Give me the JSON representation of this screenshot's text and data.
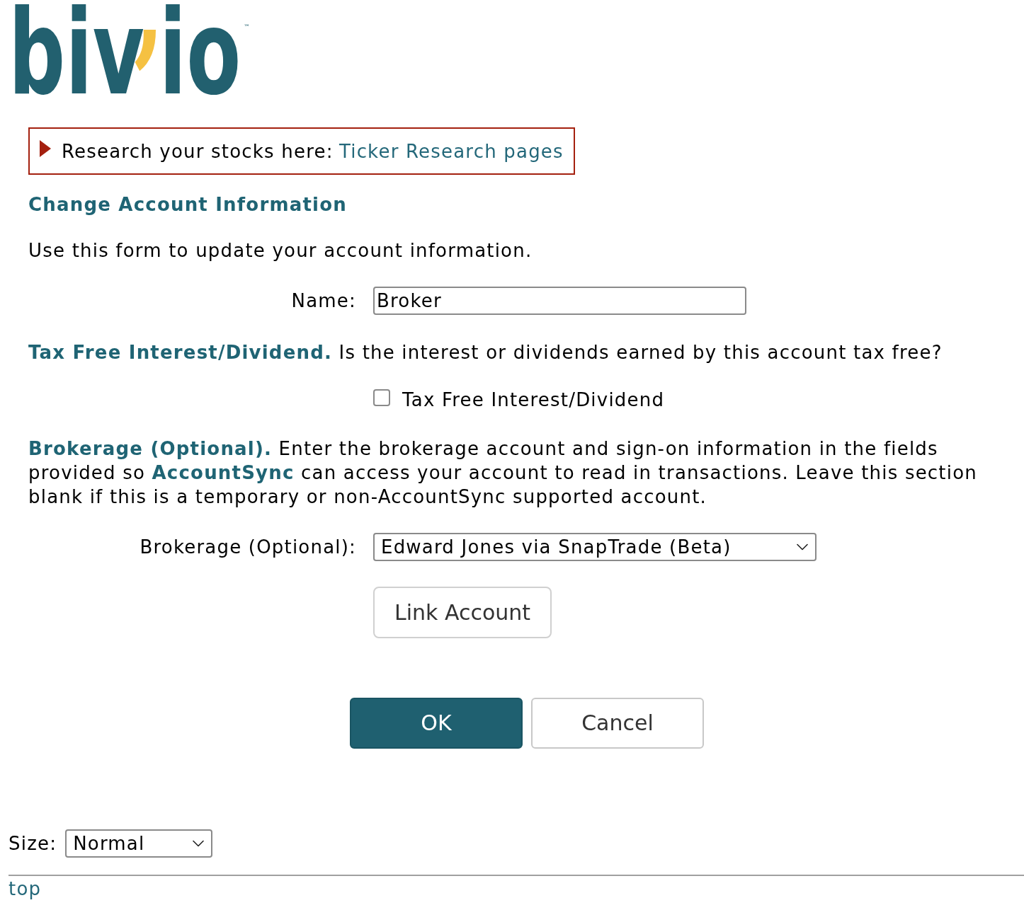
{
  "logo": {
    "text": "biv$^{,}$io",
    "mark": "™"
  },
  "notice": {
    "text": "Research your stocks here:",
    "link": "Ticker Research pages"
  },
  "heading": "Change Account Information",
  "intro": "Use this form to update your account information.",
  "name_field": {
    "label": "Name:",
    "value": "Broker"
  },
  "tax_free": {
    "description": "**Tax Free Interest/Dividend.** Is the interest or dividends earned by this account tax free?",
    "checkbox": {
      "label": "Tax Free Interest/Dividend",
      "checked": false
    }
  },
  "brokerage": {
    "description": "**Brokerage (Optional).** Enter the brokerage account and sign-on information in the fields provided so **AccountSync** can access your account to read in transactions. Leave this section blank if this is a temporary or non-AccountSync supported account.",
    "select": {
      "label": "Brokerage (Optional):",
      "value": "Edward Jones via SnapTrade (Beta)"
    },
    "link_button": "Link Account"
  },
  "buttons": [
    {
      "label": "OK",
      "kind": "primary"
    },
    {
      "label": "Cancel",
      "kind": "secondary"
    }
  ],
  "size": {
    "label": "Size:",
    "value": "Normal"
  },
  "footer_link": "top"
}
